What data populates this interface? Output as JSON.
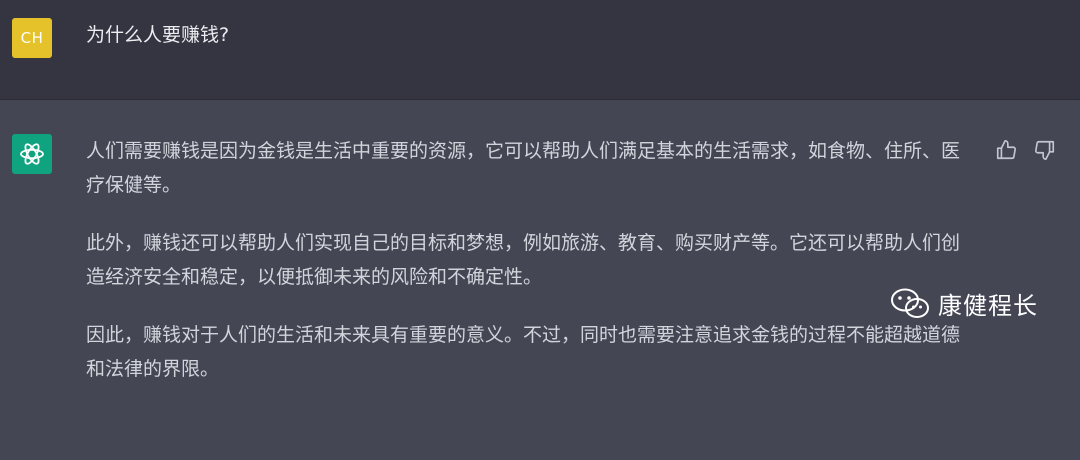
{
  "user": {
    "avatar_initials": "CH",
    "avatar_color": "#e5c12a",
    "question": "为什么人要赚钱?"
  },
  "assistant": {
    "avatar_icon": "openai-logo-icon",
    "avatar_color": "#10a37f",
    "paragraphs": [
      "人们需要赚钱是因为金钱是生活中重要的资源，它可以帮助人们满足基本的生活需求，如食物、住所、医疗保健等。",
      "此外，赚钱还可以帮助人们实现自己的目标和梦想，例如旅游、教育、购买财产等。它还可以帮助人们创造经济安全和稳定，以便抵御未来的风险和不确定性。",
      "因此，赚钱对于人们的生活和未来具有重要的意义。不过，同时也需要注意追求金钱的过程不能超越道德和法律的界限。"
    ],
    "feedback_icons": [
      "thumbs-up-icon",
      "thumbs-down-icon"
    ]
  },
  "watermark": {
    "icon": "wechat-icon",
    "text": "康健程长"
  },
  "colors": {
    "user_row_bg": "#343541",
    "assistant_row_bg": "#444654",
    "text": "#d1d5db"
  }
}
